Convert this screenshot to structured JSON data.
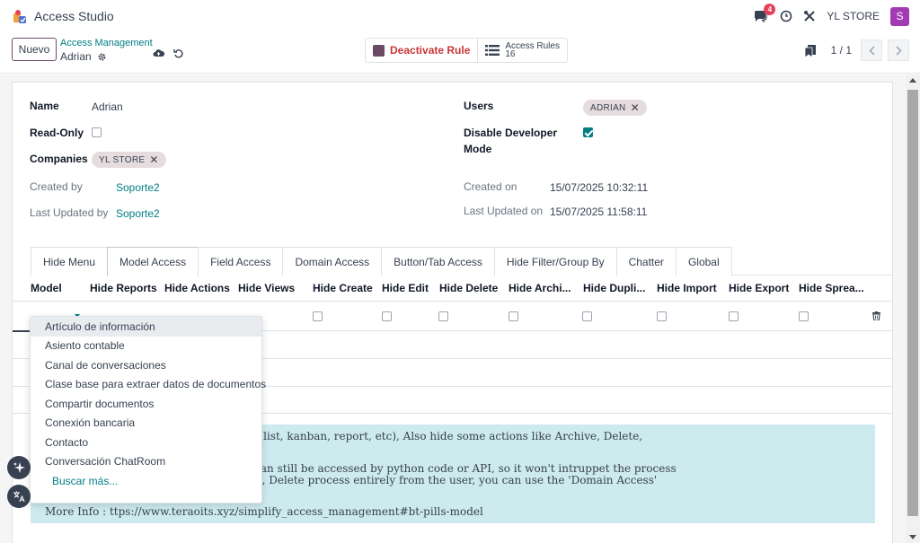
{
  "app": {
    "title": "Access Studio",
    "chat_badge": "4",
    "company": "YL STORE",
    "avatar_initial": "S"
  },
  "control": {
    "new_label": "Nuevo",
    "breadcrumb_parent": "Access Management",
    "breadcrumb_current": "Adrian",
    "deactivate_label": "Deactivate Rule",
    "access_rules_label": "Access Rules",
    "access_rules_count": "16",
    "pager_value": "1 / 1"
  },
  "form": {
    "name_label": "Name",
    "name_value": "Adrian",
    "readonly_label": "Read-Only",
    "readonly_checked": false,
    "companies_label": "Companies",
    "companies_tag": "YL STORE",
    "created_by_label": "Created by",
    "created_by_value": "Soporte2",
    "updated_by_label": "Last Updated by",
    "updated_by_value": "Soporte2",
    "users_label": "Users",
    "users_tag": "ADRIAN",
    "disable_dev_label_1": "Disable Developer",
    "disable_dev_label_2": "Mode",
    "disable_dev_checked": true,
    "created_on_label": "Created on",
    "created_on_value": "15/07/2025 10:32:11",
    "updated_on_label": "Last Updated on",
    "updated_on_value": "15/07/2025 11:58:11"
  },
  "tabs": [
    {
      "label": "Hide Menu",
      "active": false
    },
    {
      "label": "Model Access",
      "active": true
    },
    {
      "label": "Field Access",
      "active": false
    },
    {
      "label": "Domain Access",
      "active": false
    },
    {
      "label": "Button/Tab Access",
      "active": false
    },
    {
      "label": "Hide Filter/Group By",
      "active": false
    },
    {
      "label": "Chatter",
      "active": false
    },
    {
      "label": "Global",
      "active": false
    }
  ],
  "table": {
    "headers": [
      "Model",
      "Hide Reports",
      "Hide Actions",
      "Hide Views",
      "Hide Create",
      "Hide Edit",
      "Hide Delete",
      "Hide Archi...",
      "Hide Dupli...",
      "Hide Import",
      "Hide Export",
      "Hide Sprea..."
    ]
  },
  "help": {
    "line1": "s like Create, Edit, Export, Hide Views (list, kanban, report, etc), Also hide some actions like Archive, Delete,",
    "line2": "ecome hidden for defined users. They can still be accessed by python code or API, so it won't intruppet the process",
    "line3": "u strictly want to block the Create, Edit, Delete process entirely from the user, you can use the 'Domain Access'",
    "line4": "More Info : ttps://www.teraoits.xyz/simplify_access_management#bt-pills-model"
  },
  "dropdown": {
    "items": [
      "Artículo de información",
      "Asiento contable",
      "Canal de conversaciones",
      "Clase base para extraer datos de documentos",
      "Compartir documentos",
      "Conexión bancaria",
      "Contacto",
      "Conversación ChatRoom"
    ],
    "more_label": "Buscar más..."
  },
  "colors": {
    "brand": "#714b67",
    "accent": "#017e84",
    "badge": "#e3415a",
    "avatar": "#a23ab4",
    "danger": "#c93535"
  }
}
